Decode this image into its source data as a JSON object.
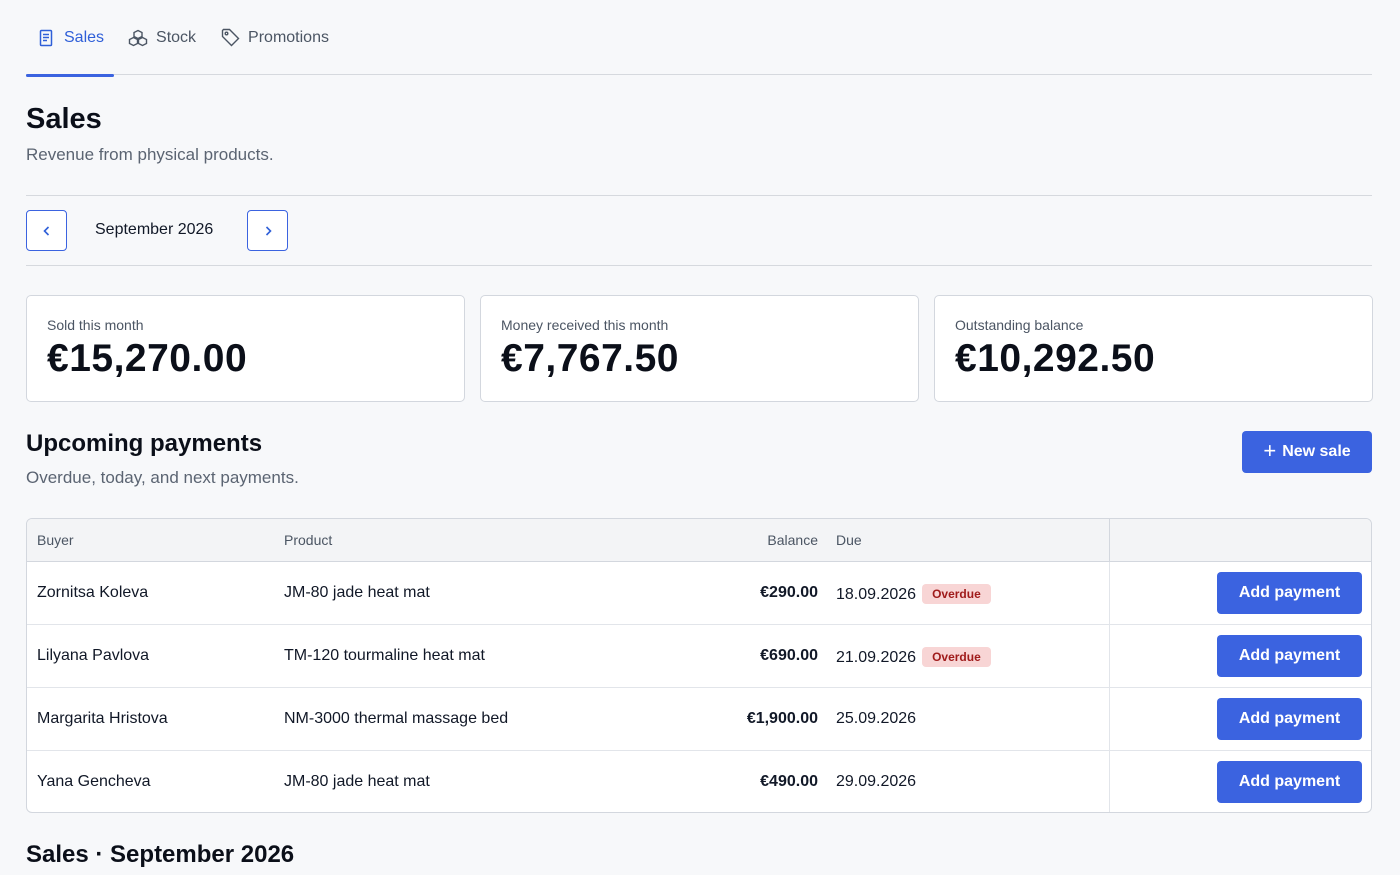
{
  "tabs": [
    {
      "label": "Sales",
      "icon": "receipt-icon",
      "active": true
    },
    {
      "label": "Stock",
      "icon": "boxes-icon",
      "active": false
    },
    {
      "label": "Promotions",
      "icon": "tag-icon",
      "active": false
    }
  ],
  "page": {
    "title": "Sales",
    "subtitle": "Revenue from physical products."
  },
  "month_nav": {
    "label": "September 2026"
  },
  "cards": [
    {
      "label": "Sold this month",
      "value": "€15,270.00"
    },
    {
      "label": "Money received this month",
      "value": "€7,767.50"
    },
    {
      "label": "Outstanding balance",
      "value": "€10,292.50"
    }
  ],
  "upcoming": {
    "title": "Upcoming payments",
    "subtitle": "Overdue, today, and next payments.",
    "new_sale_label": "New sale",
    "columns": {
      "buyer": "Buyer",
      "product": "Product",
      "balance": "Balance",
      "due": "Due"
    },
    "rows": [
      {
        "buyer": "Zornitsa Koleva",
        "product": "JM-80 jade heat mat",
        "balance": "€290.00",
        "due": "18.09.2026",
        "badge": "Overdue",
        "action": "Add payment"
      },
      {
        "buyer": "Lilyana Pavlova",
        "product": "TM-120 tourmaline heat mat",
        "balance": "€690.00",
        "due": "21.09.2026",
        "badge": "Overdue",
        "action": "Add payment"
      },
      {
        "buyer": "Margarita Hristova",
        "product": "NM-3000 thermal massage bed",
        "balance": "€1,900.00",
        "due": "25.09.2026",
        "badge": "",
        "action": "Add payment"
      },
      {
        "buyer": "Yana Gencheva",
        "product": "JM-80 jade heat mat",
        "balance": "€490.00",
        "due": "29.09.2026",
        "badge": "",
        "action": "Add payment"
      }
    ]
  },
  "sales_section": {
    "title": "Sales · September 2026"
  },
  "colors": {
    "accent": "#3b63e0",
    "overdue_bg": "#f8d5d5",
    "overdue_text": "#a01b1b"
  }
}
